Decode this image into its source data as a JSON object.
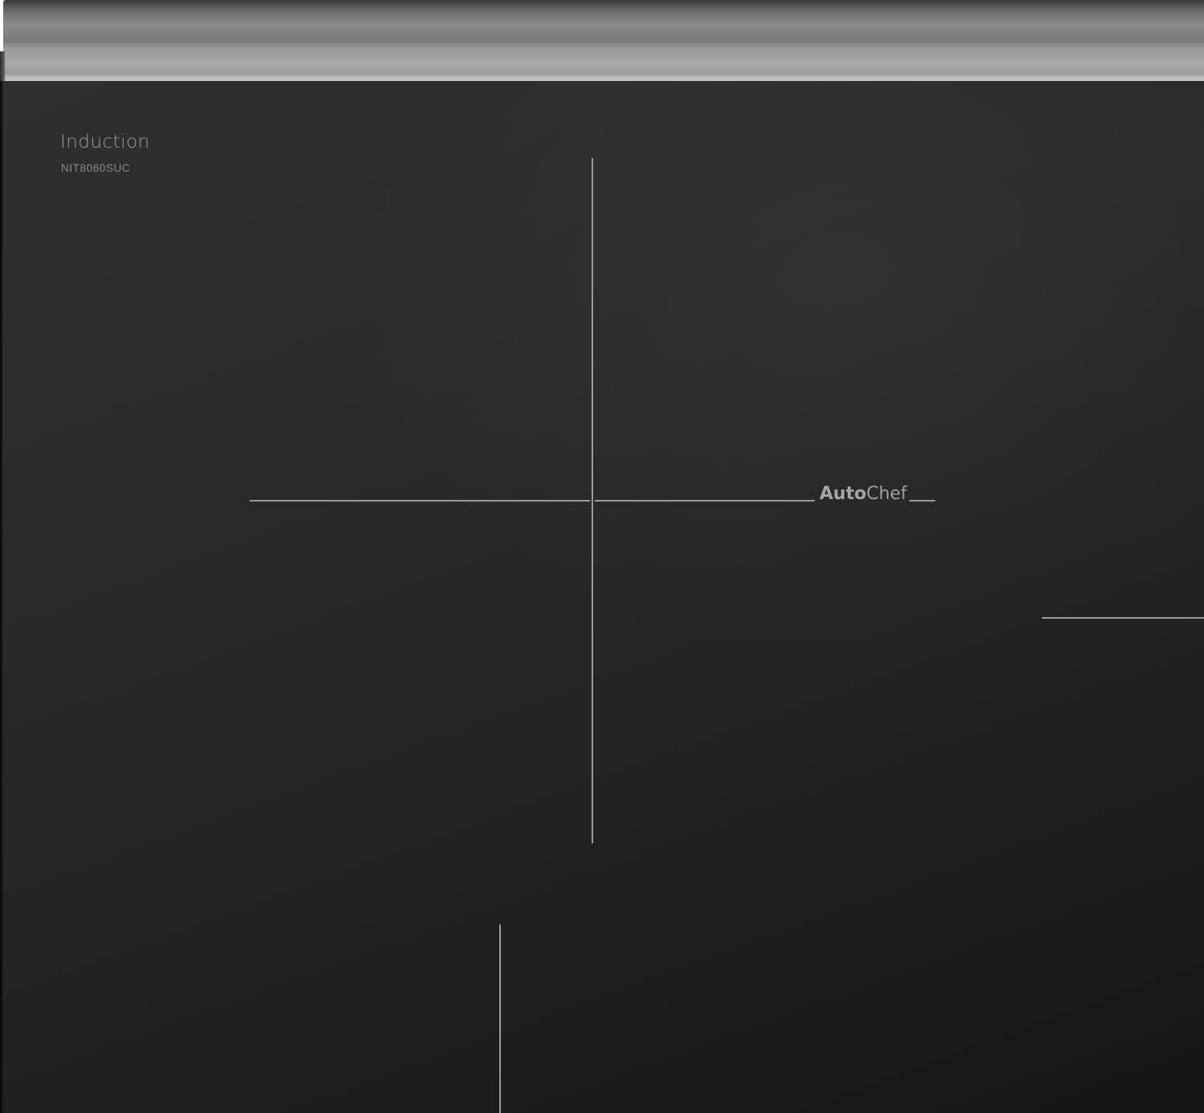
{
  "brand": {
    "title": "Induction",
    "model": "NIT8060SUC"
  },
  "feature_logo": {
    "bold_part": "Auto",
    "regular_part": "Chef"
  },
  "colors": {
    "glass": "#262626",
    "trim": "#9a9a9a",
    "zone_lines": "#9b9b9b",
    "text": "#9a9a9a"
  }
}
